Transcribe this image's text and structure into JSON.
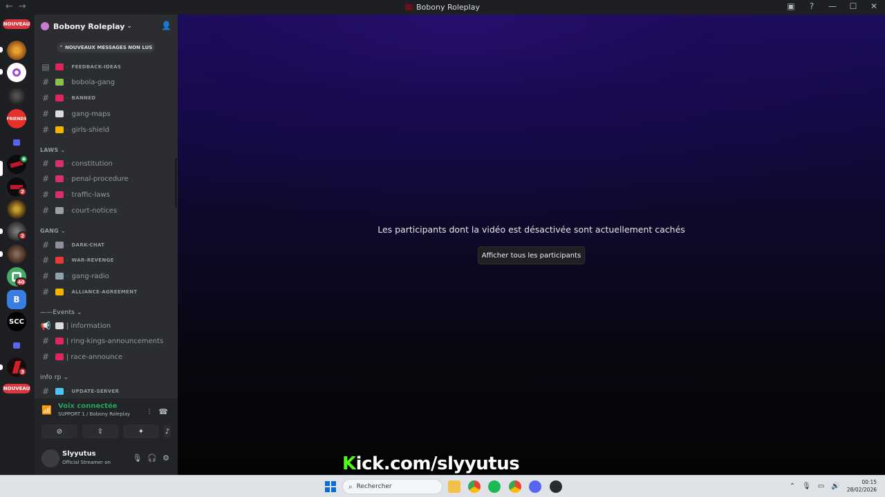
{
  "window": {
    "title": "Bobony Roleplay",
    "nav_back": "←",
    "nav_forward": "→"
  },
  "guilds": {
    "new_label": "NOUVEAU",
    "badges": [
      "2",
      "2",
      "40",
      "3"
    ],
    "items": [
      "lion",
      "bobony",
      "dark",
      "friends",
      "folder",
      "red1",
      "red2",
      "skull",
      "voice1",
      "voice2",
      "green",
      "bbox",
      "scc",
      "folder2",
      "red3"
    ],
    "friends_label": "FRIENDS",
    "scc_label": "SCC",
    "b_label": "B"
  },
  "server": {
    "name": "Bobony Roleplay",
    "unread_banner": "NOUVEAUX MESSAGES NON LUS"
  },
  "channels_top": [
    {
      "name": "FEEDBACK-IDEAS",
      "small": true,
      "emoji_color": "#e0245e",
      "icon": "forum"
    },
    {
      "name": "bobola-gang",
      "small": false,
      "emoji_color": "#8bc34a"
    },
    {
      "name": "BANNED",
      "small": true,
      "emoji_color": "#e0245e"
    },
    {
      "name": "gang-maps",
      "small": false,
      "emoji_color": "#dcdcdc"
    },
    {
      "name": "girls-shield",
      "small": false,
      "emoji_color": "#f4b400"
    }
  ],
  "category_laws": "LAWS",
  "channels_laws": [
    {
      "name": "constitution",
      "emoji_color": "#d5306a"
    },
    {
      "name": "penal-procedure",
      "emoji_color": "#d5306a"
    },
    {
      "name": "traffic-laws",
      "emoji_color": "#d5306a"
    },
    {
      "name": "court-notices",
      "emoji_color": "#9aa0a6"
    }
  ],
  "category_gang": "GANG",
  "channels_gang": [
    {
      "name": "DARK-CHAT",
      "small": true,
      "emoji_color": "#8e8e9e"
    },
    {
      "name": "WAR-REVENGE",
      "small": true,
      "emoji_color": "#e53935"
    },
    {
      "name": "gang-radio",
      "small": false,
      "emoji_color": "#90a4ae"
    },
    {
      "name": "ALLIANCE-AGREEMENT",
      "small": true,
      "emoji_color": "#f4b400"
    }
  ],
  "category_events": "——Events",
  "channels_events": [
    {
      "name": "information",
      "prefix": "| ",
      "emoji_color": "#dcdcdc",
      "type": "announce"
    },
    {
      "name": "ring-kings-announcements",
      "prefix": "| ",
      "emoji_color": "#e0245e"
    },
    {
      "name": "race-announce",
      "prefix": "| ",
      "emoji_color": "#e0245e"
    }
  ],
  "category_info": "info rp",
  "channels_info": [
    {
      "name": "UPDATE-SERVER",
      "small": true,
      "emoji_color": "#4fc3f7"
    }
  ],
  "voice": {
    "status": "Voix connectée",
    "channel": "SUPPORT 1 / Bobony Roleplay"
  },
  "user": {
    "name": "Slyyutus",
    "status": "Official Streamer on"
  },
  "main": {
    "hidden_message": "Les participants dont la vidéo est désactivée sont actuellement cachés",
    "show_all_button": "Afficher tous les participants",
    "watermark_k": "K",
    "watermark_rest": "ick.com/slyyutus"
  },
  "taskbar": {
    "search_placeholder": "Rechercher",
    "time": "00:15",
    "date": "28/02/2026"
  }
}
